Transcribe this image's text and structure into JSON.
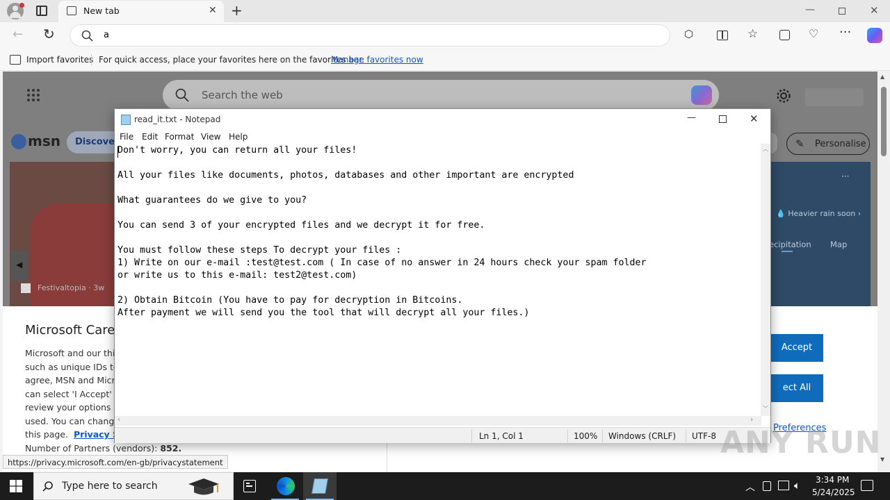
{
  "browser": {
    "tab_title": "New tab",
    "address_value": "a",
    "favorites": {
      "import_label": "Import favorites",
      "hint": "For quick access, place your favorites here on the favorites bar.",
      "manage_link": "Manage favorites now"
    },
    "status_url": "https://privacy.microsoft.com/en-gb/privacystatement"
  },
  "msn": {
    "search_placeholder": "Search the web",
    "logo_text": "msn",
    "discover_label": "Discover",
    "personalise_label": "Personalise",
    "hero_source": "Festivaltopia · 3w",
    "weather_alert": "Heavier rain soon",
    "weather_tab_precip": "ecipitation",
    "weather_tab_map": "Map",
    "privacy_title": "Microsoft Care",
    "privacy_lines": [
      "Microsoft and our thir",
      "such as unique IDs to",
      "agree, MSN and Micr",
      "can select 'I Accept' to",
      "review your options a",
      "used.  You can change"
    ],
    "privacy_last_prefix": "this page.",
    "privacy_link": "Privacy St",
    "partners_label": "Number of Partners (vendors):",
    "partners_count": "852.",
    "accept_label": "Accept",
    "reject_label": "ect All",
    "preferences_label": "Preferences"
  },
  "notepad": {
    "title": "read_it.txt - Notepad",
    "menu": [
      "File",
      "Edit",
      "Format",
      "View",
      "Help"
    ],
    "lines": [
      "Don't worry, you can return all your files!",
      "",
      "All your files like documents, photos, databases and other important are encrypted",
      "",
      "What guarantees do we give to you?",
      "",
      "You can send 3 of your encrypted files and we decrypt it for free.",
      "",
      "You must follow these steps To decrypt your files :",
      "1) Write on our e-mail :test@test.com ( In case of no answer in 24 hours check your spam folder",
      "or write us to this e-mail: test2@test.com)",
      "",
      "2) Obtain Bitcoin (You have to pay for decryption in Bitcoins.",
      "After payment we will send you the tool that will decrypt all your files.)"
    ],
    "status": {
      "position": "Ln 1, Col 1",
      "zoom": "100%",
      "line_ending": "Windows (CRLF)",
      "encoding": "UTF-8"
    }
  },
  "taskbar": {
    "search_placeholder": "Type here to search",
    "time": "3:34 PM",
    "date": "5/24/2025"
  },
  "watermark": "ANY RUN",
  "colors": {
    "accent_blue": "#0f6cbd",
    "taskbar_bg": "#1c1c1c",
    "link_blue": "#0b57d0"
  }
}
